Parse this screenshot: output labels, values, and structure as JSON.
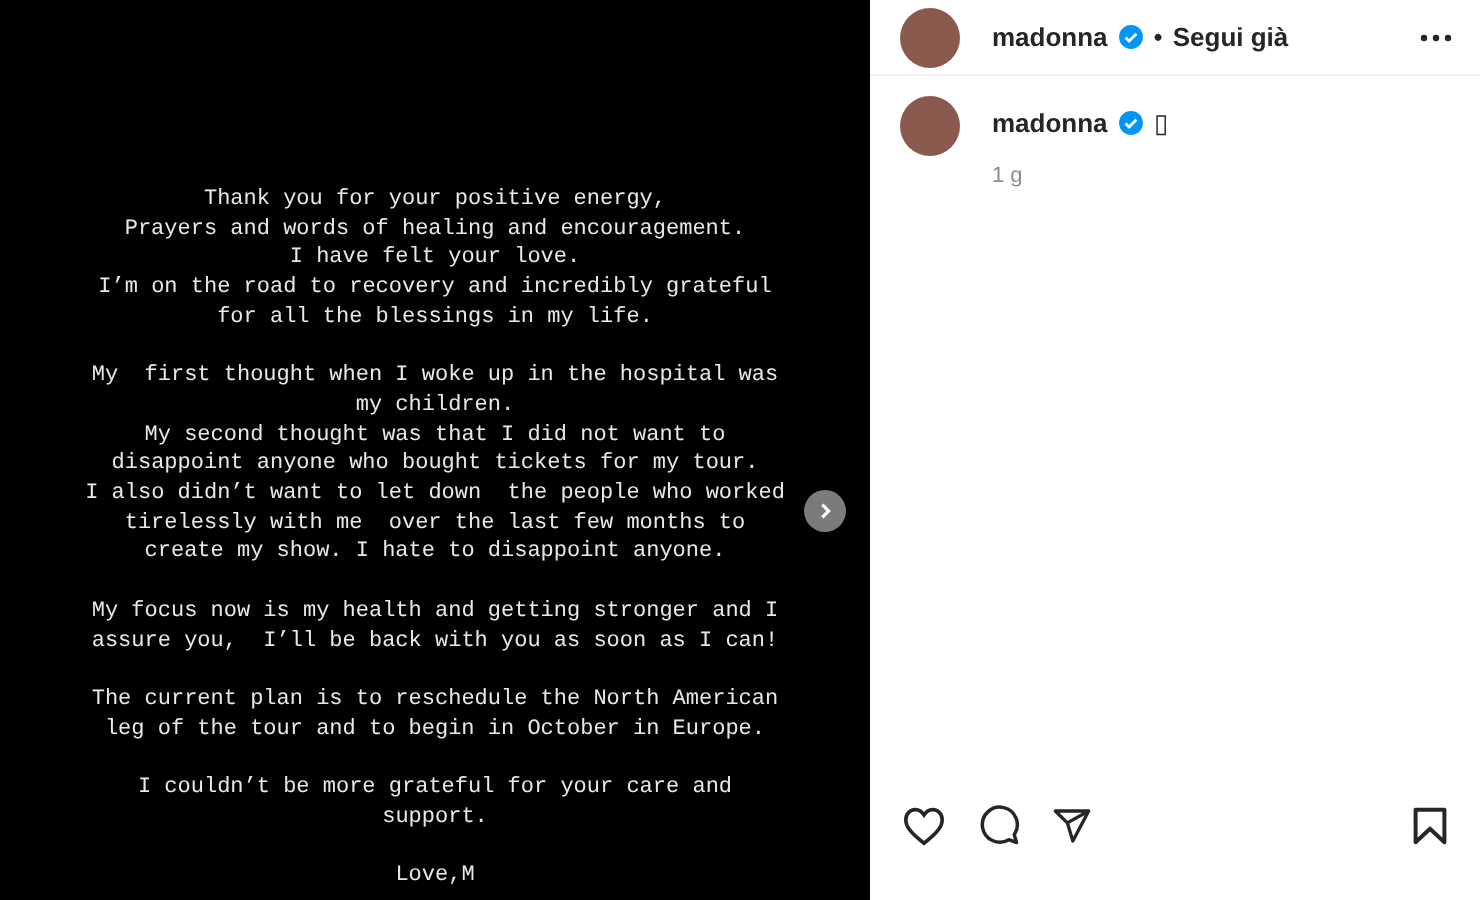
{
  "post_image": {
    "paragraphs": [
      [
        "Thank you for your positive energy,",
        "Prayers and words of healing and encouragement.",
        "I have felt your love.",
        "I’m on the road to recovery and incredibly grateful",
        "for all the blessings in my life."
      ],
      [
        "My  first thought when I woke up in the hospital was",
        "my children.",
        "My second thought was that I did not want to",
        "disappoint anyone who bought tickets for my tour.",
        "I also didn’t want to let down  the people who worked",
        "tirelessly with me  over the last few months to",
        "create my show. I hate to disappoint anyone."
      ],
      [
        "My focus now is my health and getting stronger and I",
        "assure you,  I’ll be back with you as soon as I can!"
      ],
      [
        "The current plan is to reschedule the North American",
        "leg of the tour and to begin in October in Europe."
      ],
      [
        "I couldn’t be more grateful for your care and",
        "support."
      ],
      [
        "Love,M"
      ]
    ]
  },
  "header": {
    "username": "madonna",
    "verified": true,
    "separator": "•",
    "follow_label": "Segui già"
  },
  "caption": {
    "username": "madonna",
    "verified": true,
    "text": "▯",
    "time": "1 g"
  }
}
